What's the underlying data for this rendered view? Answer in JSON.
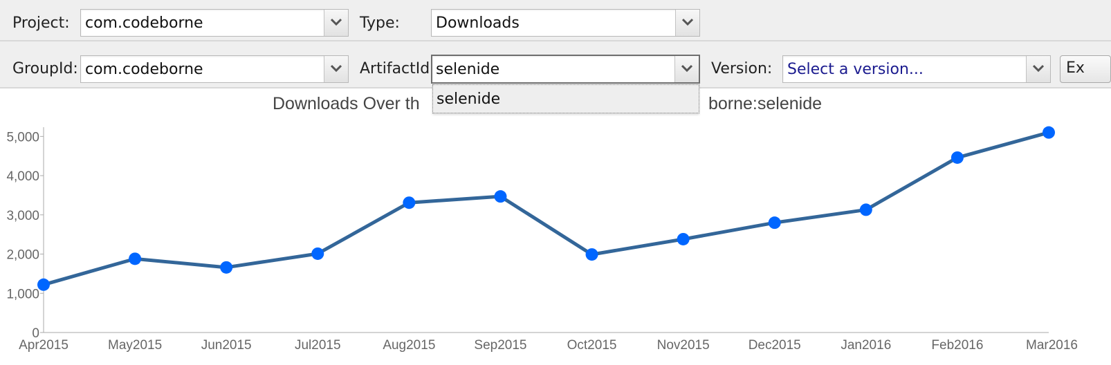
{
  "toolbar": {
    "project_label": "Project:",
    "project_value": "com.codeborne",
    "type_label": "Type:",
    "type_value": "Downloads",
    "groupid_label": "GroupId:",
    "groupid_value": "com.codeborne",
    "artifactid_label": "ArtifactId:",
    "artifactid_value": "selenide",
    "version_label": "Version:",
    "version_placeholder": "Select a version...",
    "export_label": "Ex"
  },
  "dropdown": {
    "options": [
      "selenide"
    ]
  },
  "chart_data": {
    "type": "line",
    "title": "Downloads Over th",
    "title_tail": "borne:selenide",
    "categories": [
      "Apr2015",
      "May2015",
      "Jun2015",
      "Jul2015",
      "Aug2015",
      "Sep2015",
      "Oct2015",
      "Nov2015",
      "Dec2015",
      "Jan2016",
      "Feb2016",
      "Mar2016"
    ],
    "values": [
      1220,
      1880,
      1660,
      2010,
      3310,
      3470,
      1990,
      2380,
      2800,
      3130,
      4460,
      5100
    ],
    "yticks": [
      "0",
      "1,000",
      "2,000",
      "3,000",
      "4,000",
      "5,000"
    ],
    "ylim": [
      0,
      5200
    ],
    "grid": false,
    "line_color": "#336699",
    "point_color": "#0066ff"
  }
}
